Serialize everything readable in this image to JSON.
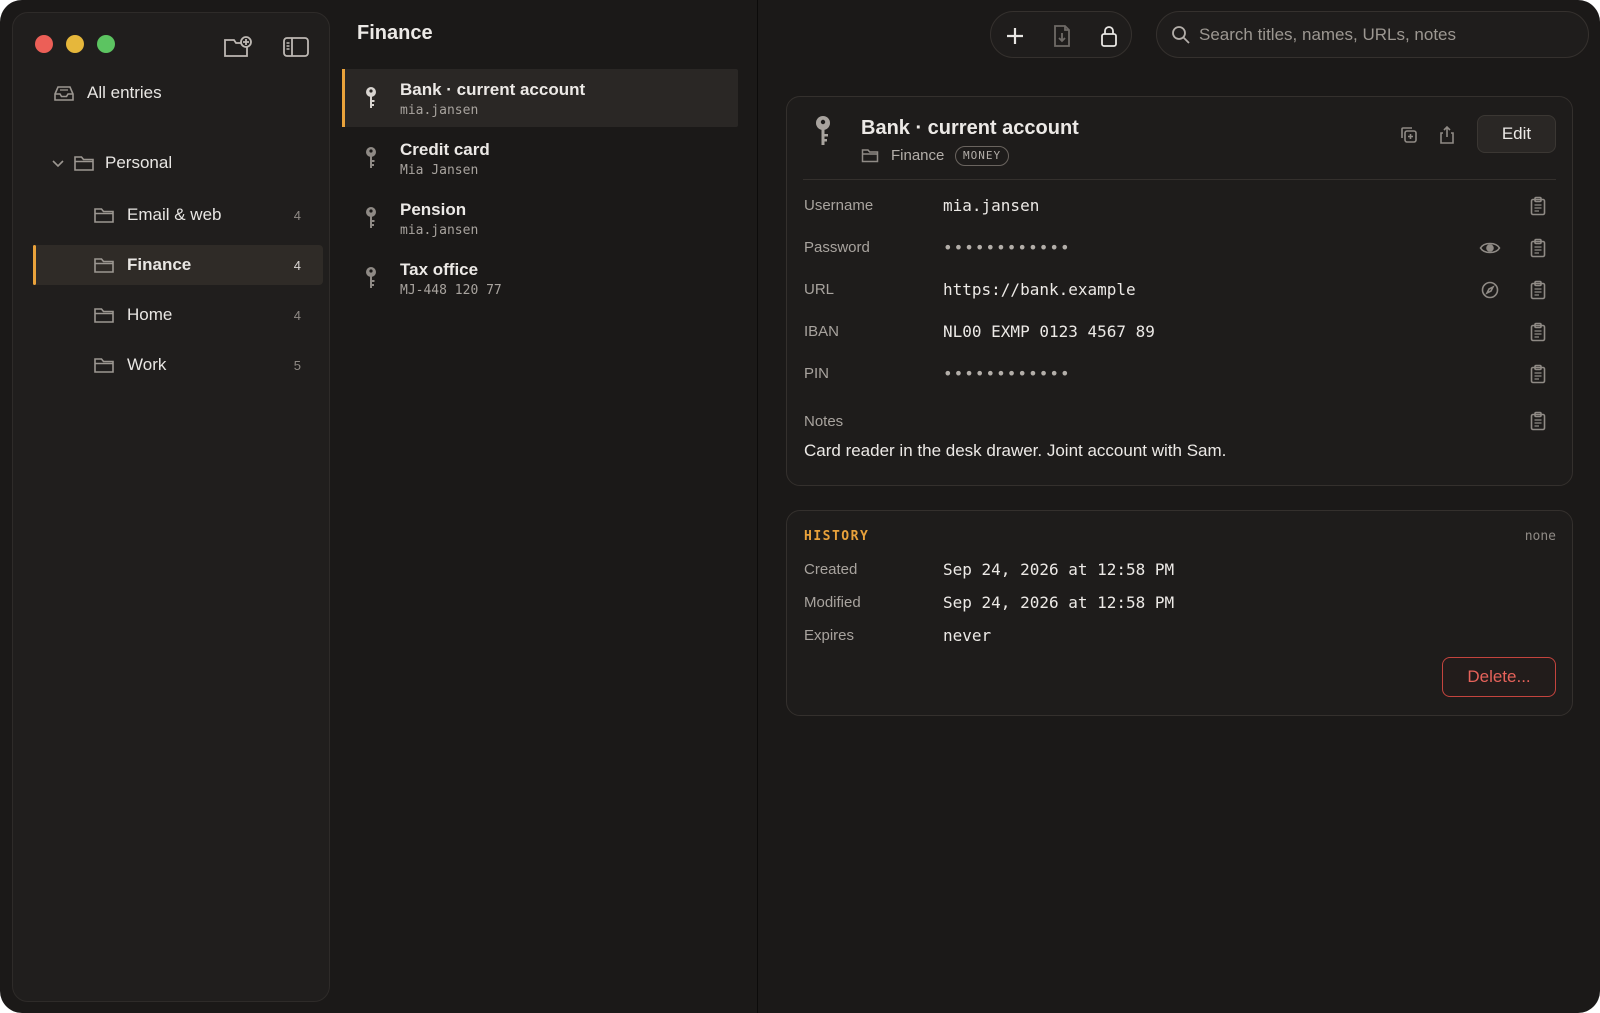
{
  "sidebar": {
    "all_entries": "All entries",
    "group": {
      "label": "Personal"
    },
    "folders": [
      {
        "label": "Email & web",
        "count": "4"
      },
      {
        "label": "Finance",
        "count": "4"
      },
      {
        "label": "Home",
        "count": "4"
      },
      {
        "label": "Work",
        "count": "5"
      }
    ]
  },
  "list": {
    "title": "Finance",
    "entries": [
      {
        "title": "Bank · current account",
        "subtitle": "mia.jansen"
      },
      {
        "title": "Credit card",
        "subtitle": "Mia Jansen"
      },
      {
        "title": "Pension",
        "subtitle": "mia.jansen"
      },
      {
        "title": "Tax office",
        "subtitle": "MJ-448 120 77"
      }
    ]
  },
  "search": {
    "placeholder": "Search titles, names, URLs, notes"
  },
  "detail": {
    "title": "Bank · current account",
    "folder": "Finance",
    "tag": "MONEY",
    "edit_label": "Edit",
    "fields": {
      "username": {
        "label": "Username",
        "value": "mia.jansen"
      },
      "password": {
        "label": "Password",
        "value": "••••••••••••"
      },
      "url": {
        "label": "URL",
        "value": "https://bank.example"
      },
      "iban": {
        "label": "IBAN",
        "value": "NL00 EXMP 0123 4567 89"
      },
      "pin": {
        "label": "PIN",
        "value": "••••••••••••"
      }
    },
    "notes": {
      "label": "Notes",
      "value": "Card reader in the desk drawer. Joint account with Sam."
    }
  },
  "history": {
    "label": "HISTORY",
    "status": "none",
    "created": {
      "label": "Created",
      "value": "Sep 24, 2026 at 12:58 PM"
    },
    "modified": {
      "label": "Modified",
      "value": "Sep 24, 2026 at 12:58 PM"
    },
    "expires": {
      "label": "Expires",
      "value": "never"
    },
    "delete_label": "Delete..."
  },
  "colors": {
    "accent": "#e9a23b",
    "danger": "#e6625a",
    "background": "#1b1918"
  }
}
